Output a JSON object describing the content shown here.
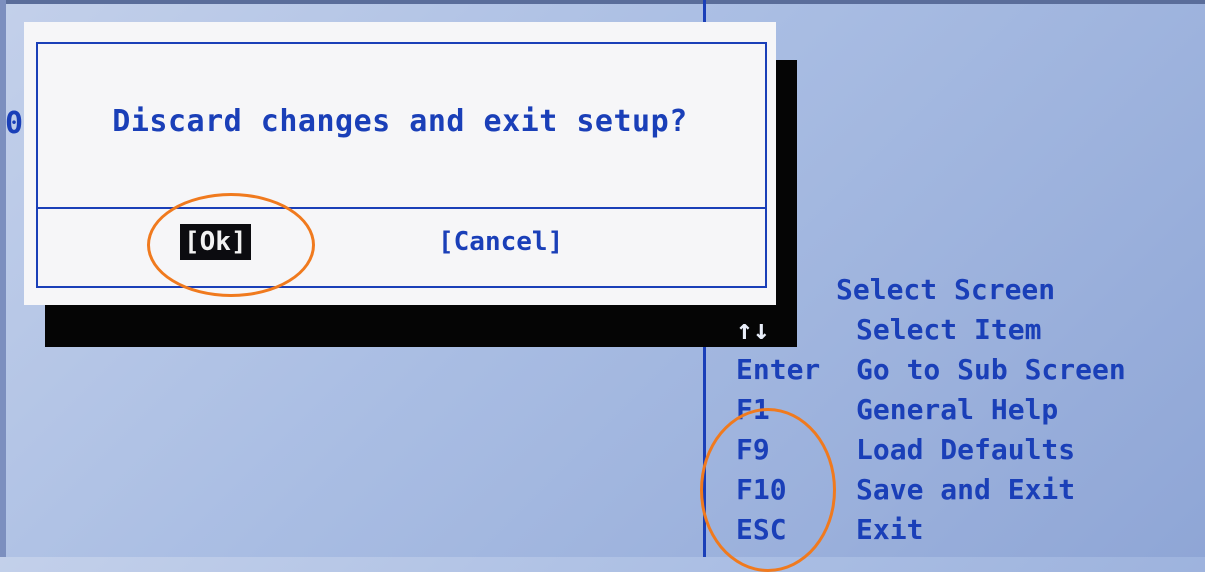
{
  "dialog": {
    "message": "Discard changes and exit setup?",
    "ok_label": "[Ok]",
    "cancel_label": "[Cancel]"
  },
  "edge_glyph": "0",
  "help": {
    "items": [
      {
        "key": "",
        "desc": "Select Screen"
      },
      {
        "key": "↑↓",
        "desc": "Select Item"
      },
      {
        "key": "Enter",
        "desc": "Go to Sub Screen"
      },
      {
        "key": "F1",
        "desc": "General Help"
      },
      {
        "key": "F9",
        "desc": "Load Defaults"
      },
      {
        "key": "F10",
        "desc": "Save and Exit"
      },
      {
        "key": "ESC",
        "desc": "Exit"
      }
    ]
  },
  "colors": {
    "bios_blue": "#1a3fb8",
    "background": "#a9bde3",
    "highlight_circle": "#f07a1e",
    "dialog_bg": "#f6f6f8"
  }
}
